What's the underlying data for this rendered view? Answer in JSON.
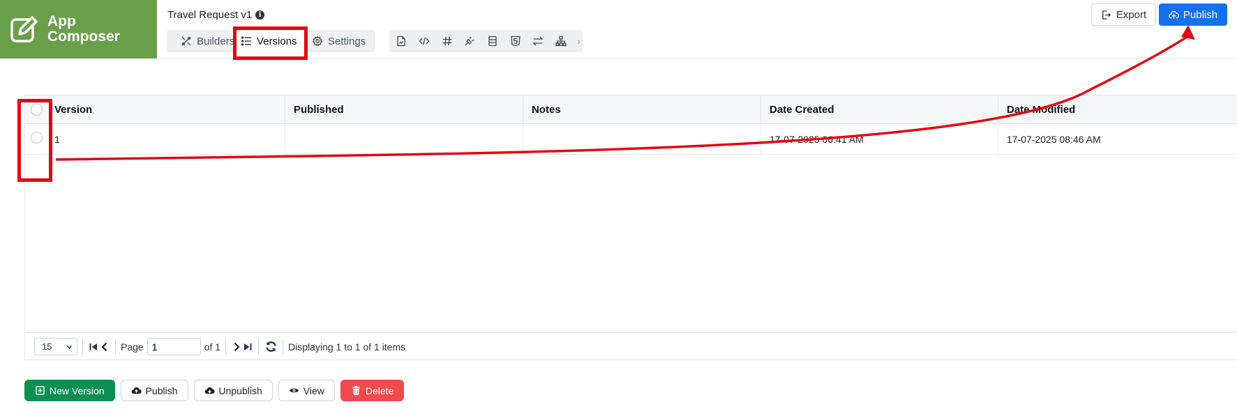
{
  "colors": {
    "brand": "#6a9f4a",
    "primary": "#1570ef",
    "success": "#0e8f52",
    "danger": "#f04a4f",
    "annotation": "#e30613"
  },
  "app": {
    "name_line1": "App",
    "name_line2": "Composer",
    "title": "Travel Request v1",
    "info_icon": "i"
  },
  "tabs": [
    {
      "label": "Builders",
      "icon": "builders-icon"
    },
    {
      "label": "Versions",
      "icon": "list-icon",
      "active": true
    },
    {
      "label": "Settings",
      "icon": "gear-icon"
    }
  ],
  "toolbar_icons": [
    "file-icon",
    "code-icon",
    "hash-icon",
    "plug-icon",
    "table-icon",
    "html5-icon",
    "swap-icon",
    "sitemap-icon"
  ],
  "header_buttons": {
    "export": "Export",
    "publish": "Publish"
  },
  "grid": {
    "columns": [
      "Version",
      "Published",
      "Notes",
      "Date Created",
      "Date Modified"
    ],
    "rows": [
      {
        "version": "1",
        "published": "",
        "notes": "",
        "date_created": "17-07-2025 06:41 AM",
        "date_modified": "17-07-2025 08:46 AM"
      }
    ]
  },
  "pager": {
    "page_size": "15",
    "page_label": "Page",
    "page_value": "1",
    "of_label": "of 1",
    "status": "Displaying 1 to 1 of 1 items"
  },
  "actions": {
    "new_version": "New Version",
    "publish": "Publish",
    "unpublish": "Unpublish",
    "view": "View",
    "delete": "Delete"
  }
}
